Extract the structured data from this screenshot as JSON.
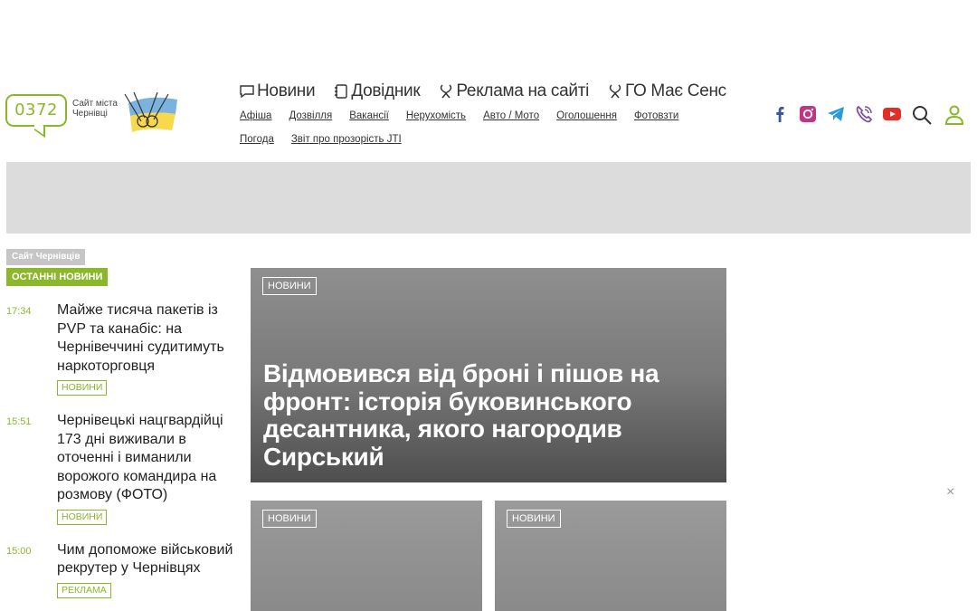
{
  "logo": {
    "number": "0372",
    "city_line1": "Сайт міста",
    "city_line2": "Чернівці"
  },
  "main_nav": [
    {
      "label": "Новини",
      "icon": "chat-bubble-icon"
    },
    {
      "label": "Довідник",
      "icon": "notebook-icon"
    },
    {
      "label": "Реклама на сайті",
      "icon": "ribbon-icon"
    },
    {
      "label": "ГО Має Сенс",
      "icon": "ribbon-icon"
    }
  ],
  "sub_nav": [
    "Афіша",
    "Дозвілля",
    "Вакансії",
    "Нерухомість",
    "Авто / Мото",
    "Оголошення",
    "Фотовзти",
    "Погода",
    "Звіт про прозорість JTI"
  ],
  "social": [
    {
      "name": "facebook-icon",
      "color": "#3b5998"
    },
    {
      "name": "instagram-icon",
      "color": "#c13584"
    },
    {
      "name": "telegram-icon",
      "color": "#2a9bd8"
    },
    {
      "name": "viber-icon",
      "color": "#7b519d"
    },
    {
      "name": "youtube-icon",
      "color": "#e52d27"
    }
  ],
  "colors": {
    "accent": "#8bb82a"
  },
  "section": {
    "site_label": "Сайт Чернівців",
    "latest_label": "ОСТАННІ НОВИНИ"
  },
  "news": [
    {
      "time": "17:34",
      "title": "Майже тисяча пакетів із PVP та канабіс: на Чернівеччині судитимуть наркоторговця",
      "tag": "НОВИНИ"
    },
    {
      "time": "15:51",
      "title": "Чернівецькі нацгвардійці 173 дні виживали в оточенні і виманили ворожого командира на розмову (ФОТО)",
      "tag": "НОВИНИ"
    },
    {
      "time": "15:00",
      "title": "Чим допоможе військовий рекрутер у Чернівцях",
      "tag": "РЕКЛАМА"
    }
  ],
  "featured": {
    "main": {
      "tag": "НОВИНИ",
      "title": "Відмовився від броні і пішов на фронт: історія буковинського десантника, якого нагородив Сирський"
    },
    "small": [
      {
        "tag": "НОВИНИ"
      },
      {
        "tag": "НОВИНИ"
      }
    ]
  },
  "close_label": "×"
}
